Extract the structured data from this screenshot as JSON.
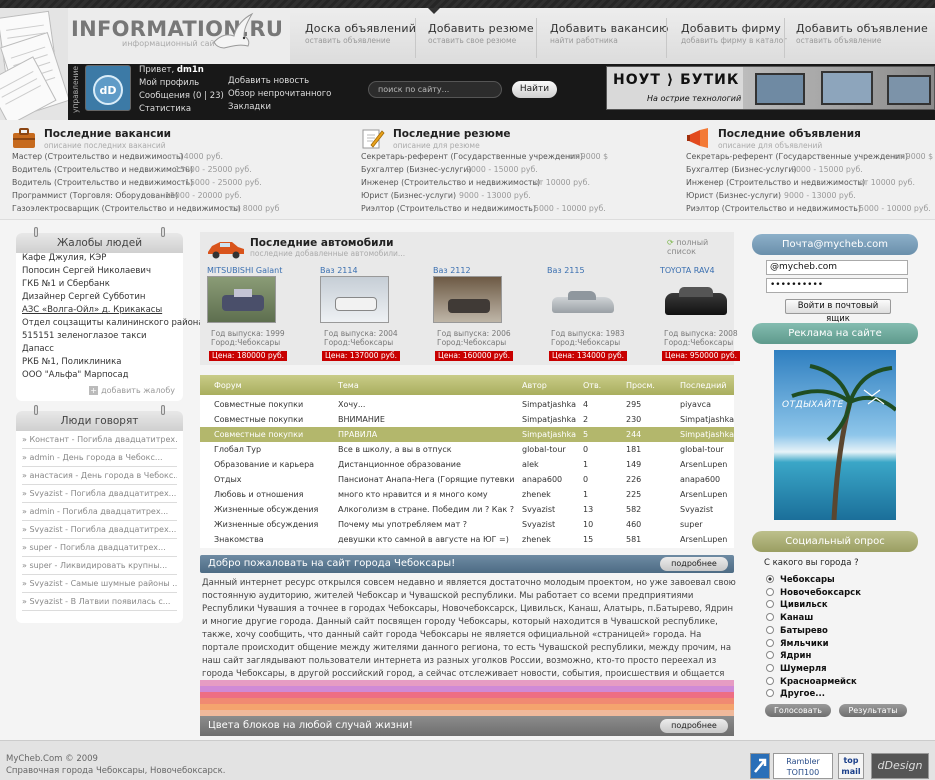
{
  "header": {
    "logo": "INFORMATION.RU",
    "logo_sub": "информационный сайт",
    "nav": [
      {
        "title": "Доска объявлений",
        "sub": "оставить объявление"
      },
      {
        "title": "Добавить резюме",
        "sub": "оставить свое резюме"
      },
      {
        "title": "Добавить вакансию",
        "sub": "найти работника"
      },
      {
        "title": "Добавить фирму",
        "sub": "добавить фирму в каталог"
      },
      {
        "title": "Добавить объявление",
        "sub": "оставить объявление"
      }
    ]
  },
  "userbar": {
    "vertical_label": "управление",
    "greeting": "Привет,",
    "username": "dm1n",
    "links_col1": [
      "Мой профиль",
      "Сообщения (0 | 23)",
      "Статистика"
    ],
    "links_col2": [
      "Добавить новость",
      "Обзор непрочитанного",
      "Закладки"
    ],
    "search_placeholder": "поиск по сайту...",
    "search_button": "Найти",
    "banner_logo": "НОУТ ⟩ БУТИК",
    "banner_tagline": "На острие технологий"
  },
  "latest": [
    {
      "title": "Последние вакансии",
      "sub": "описание последних вакансий",
      "rows": [
        {
          "text": "Мастер (Строительство и недвижимость)",
          "price": "от 14000 руб."
        },
        {
          "text": "Водитель (Строительство и недвижимость)",
          "price": "15000 - 25000 руб."
        },
        {
          "text": "Водитель (Строительство и недвижимость)",
          "price": "15000 - 25000 руб."
        },
        {
          "text": "Программист (Торговля: Оборудование)",
          "price": "15000 - 20000 руб."
        },
        {
          "text": "Газоэлектросварщик (Строительство и недвижимость)",
          "price": "от 8000 руб"
        }
      ]
    },
    {
      "title": "Последние резюме",
      "sub": "описание для резюме",
      "rows": [
        {
          "text": "Секретарь-референт (Государственные учреждения)",
          "price": "от 9000 $"
        },
        {
          "text": "Бухгалтер (Бизнес-услуги)",
          "price": "9000 - 15000 руб."
        },
        {
          "text": "Инженер (Строительство и недвижимость)",
          "price": "от 10000 руб."
        },
        {
          "text": "Юрист (Бизнес-услуги)",
          "price": "9000 - 13000 руб."
        },
        {
          "text": "Риэлтор (Строительство и недвижимость)",
          "price": "5000 - 10000 руб."
        }
      ]
    },
    {
      "title": "Последние объявления",
      "sub": "описание для объявлений",
      "rows": [
        {
          "text": "Секретарь-референт (Государственные учреждения)",
          "price": "от 9000 $"
        },
        {
          "text": "Бухгалтер (Бизнес-услуги)",
          "price": "9000 - 15000 руб."
        },
        {
          "text": "Инженер (Строительство и недвижимость)",
          "price": "от 10000 руб."
        },
        {
          "text": "Юрист (Бизнес-услуги)",
          "price": "9000 - 13000 руб."
        },
        {
          "text": "Риэлтор (Строительство и недвижимость)",
          "price": "5000 - 10000 руб."
        }
      ]
    }
  ],
  "complaints": {
    "title": "Жалобы людей",
    "items": [
      "Кафе Джулия, КЭР",
      "Попосин Сергей Николаевич",
      "ГКБ №1 и Сбербанк",
      "Дизайнер Сергей Субботин",
      "АЗС «Волга-Ойл» д. Крикакасы",
      "Отдел соцзащиты калининского района",
      "515151 зеленоглазое такси",
      "Дапасс",
      "РКБ №1, Поликлиника",
      "ООО \"Альфа\" Марпосад"
    ],
    "add_link": "добавить жалобу"
  },
  "people_say": {
    "title": "Люди говорят",
    "items": [
      "Констант - Погибла двадцатитрех...",
      "admin - День города в Чебокс...",
      "анастасия - День города в Чебокс...",
      "Svyazist - Погибла двадцатитрех...",
      "admin - Погибла двадцатитрех...",
      "Svyazist - Погибла двадцатитрех...",
      "super - Погибла двадцатитрех...",
      "super - Ликвидировать крупны...",
      "Svyazist - Самые шумные районы ...",
      "Svyazist - В Латвии появилась с..."
    ]
  },
  "cars": {
    "title": "Последние автомобили",
    "sub": "последние добавленные автомобили...",
    "full_list": "полный список",
    "items": [
      {
        "name": "MITSUBISHI Galant",
        "year": "Год выпуска: 1999",
        "city": "Город:Чебоксары",
        "price": "Цена: 180000 руб."
      },
      {
        "name": "Ваз 2114",
        "year": "Год выпуска: 2004",
        "city": "Город:Чебоксары",
        "price": "Цена: 137000 руб."
      },
      {
        "name": "Ваз 2112",
        "year": "Год выпуска: 2006",
        "city": "Город:Чебоксары",
        "price": "Цена: 160000 руб."
      },
      {
        "name": "Ваз 2115",
        "year": "Год выпуска: 1983",
        "city": "Город:Чебоксары",
        "price": "Цена: 134000 руб."
      },
      {
        "name": "TOYOTA RAV4",
        "year": "Год выпуска: 2008",
        "city": "Город:Чебоксары",
        "price": "Цена: 950000 руб."
      }
    ]
  },
  "forum": {
    "columns": [
      "Форум",
      "Тема",
      "Автор",
      "Отв.",
      "Просм.",
      "Последний"
    ],
    "rows": [
      {
        "forum": "Совместные покупки",
        "topic": "Хочу...",
        "author": "Simpatjashka",
        "replies": "4",
        "views": "295",
        "last": "piyavca"
      },
      {
        "forum": "Совместные покупки",
        "topic": "ВНИМАНИЕ",
        "author": "Simpatjashka",
        "replies": "2",
        "views": "230",
        "last": "Simpatjashka"
      },
      {
        "forum": "Совместные покупки",
        "topic": "ПРАВИЛА",
        "author": "Simpatjashka",
        "replies": "5",
        "views": "244",
        "last": "Simpatjashka"
      },
      {
        "forum": "Глобал Тур",
        "topic": "Все в школу, а вы в отпуск",
        "author": "global-tour",
        "replies": "0",
        "views": "181",
        "last": "global-tour"
      },
      {
        "forum": "Образование и карьера",
        "topic": "Дистанционное образование",
        "author": "alek",
        "replies": "1",
        "views": "149",
        "last": "ArsenLupen"
      },
      {
        "forum": "Отдых",
        "topic": "Пансионат Анапа-Нега (Горящие путевки",
        "author": "anapa600",
        "replies": "0",
        "views": "226",
        "last": "anapa600"
      },
      {
        "forum": "Любовь и отношения",
        "topic": "много кто нравится и я много кому",
        "author": "zhenek",
        "replies": "1",
        "views": "225",
        "last": "ArsenLupen"
      },
      {
        "forum": "Жизненные обсуждения",
        "topic": "Алкоголизм в стране. Победим ли ? Как ?",
        "author": "Svyazist",
        "replies": "13",
        "views": "582",
        "last": "Svyazist"
      },
      {
        "forum": "Жизненные обсуждения",
        "topic": "Почему мы употребляем мат ?",
        "author": "Svyazist",
        "replies": "10",
        "views": "460",
        "last": "super"
      },
      {
        "forum": "Знакомства",
        "topic": "девушки кто самной в августе на ЮГ =)",
        "author": "zhenek",
        "replies": "15",
        "views": "581",
        "last": "ArsenLupen"
      }
    ]
  },
  "welcome": {
    "title": "Добро пожаловать на сайт города Чебоксары!",
    "more": "подробнее",
    "text": "Данный интернет ресурс открылся совсем недавно и является достаточно молодым проектом, но уже завоевал свою постоянную аудиторию, жителей Чебоксар и Чувашской республики. Мы работает со всеми предприятиями Республики Чувашия а точнее в городах Чебоксары, Новочебоксарск, Цивильск, Канаш, Алатырь, п.Батырево, Ядрин и многие другие города. Данный сайт посвящен городу Чебоксары, который находится в Чувашской республике, также, хочу сообщить, что данный сайт города Чебоксары не является официальной «страницей» города. На портале происходит общение между жителями данного региона, то есть Чувашской республики, между прочим, на наш сайт заглядывают пользователи интернета из разных уголков России, возможно, кто-то просто переехал из города Чебоксары, в другой российский город, а сейчас отслеживает новости, события, происшествия и общается со своими знакомыми, друзьями, близкими людьми, родителями."
  },
  "colors_block": {
    "title": "Цвета блоков на любой случай жизни!",
    "more": "подробнее"
  },
  "mail": {
    "title": "Почта@mycheb.com",
    "login_value": "@mycheb.com",
    "password_value": "••••••••••",
    "button": "Войти в почтовый ящик"
  },
  "ads": {
    "title": "Реклама на сайте",
    "ad_text": "ОТДЫХАЙТЕ"
  },
  "poll": {
    "title": "Социальный опрос",
    "question": "С какого вы города ?",
    "options": [
      "Чебоксары",
      "Новочебоксарск",
      "Цивильск",
      "Канаш",
      "Батырево",
      "Ямльчики",
      "Ядрин",
      "Шумерля",
      "Красноармейск",
      "Другое..."
    ],
    "selected": 0,
    "vote_button": "Голосовать",
    "results_button": "Результаты"
  },
  "footer": {
    "copyright": "MyCheb.Com © 2009",
    "subtitle": "Справочная города Чебоксары, Новочебоксарск.",
    "badges": [
      "Rambler ТОП100",
      "top mail",
      "dDesign"
    ]
  },
  "colors": {
    "accent_olive": "#b3b76c",
    "mail_bar": "#7a9db8",
    "ads_bar": "#6ea79a",
    "poll_bar": "#a4a872",
    "price_red": "#c80000"
  }
}
